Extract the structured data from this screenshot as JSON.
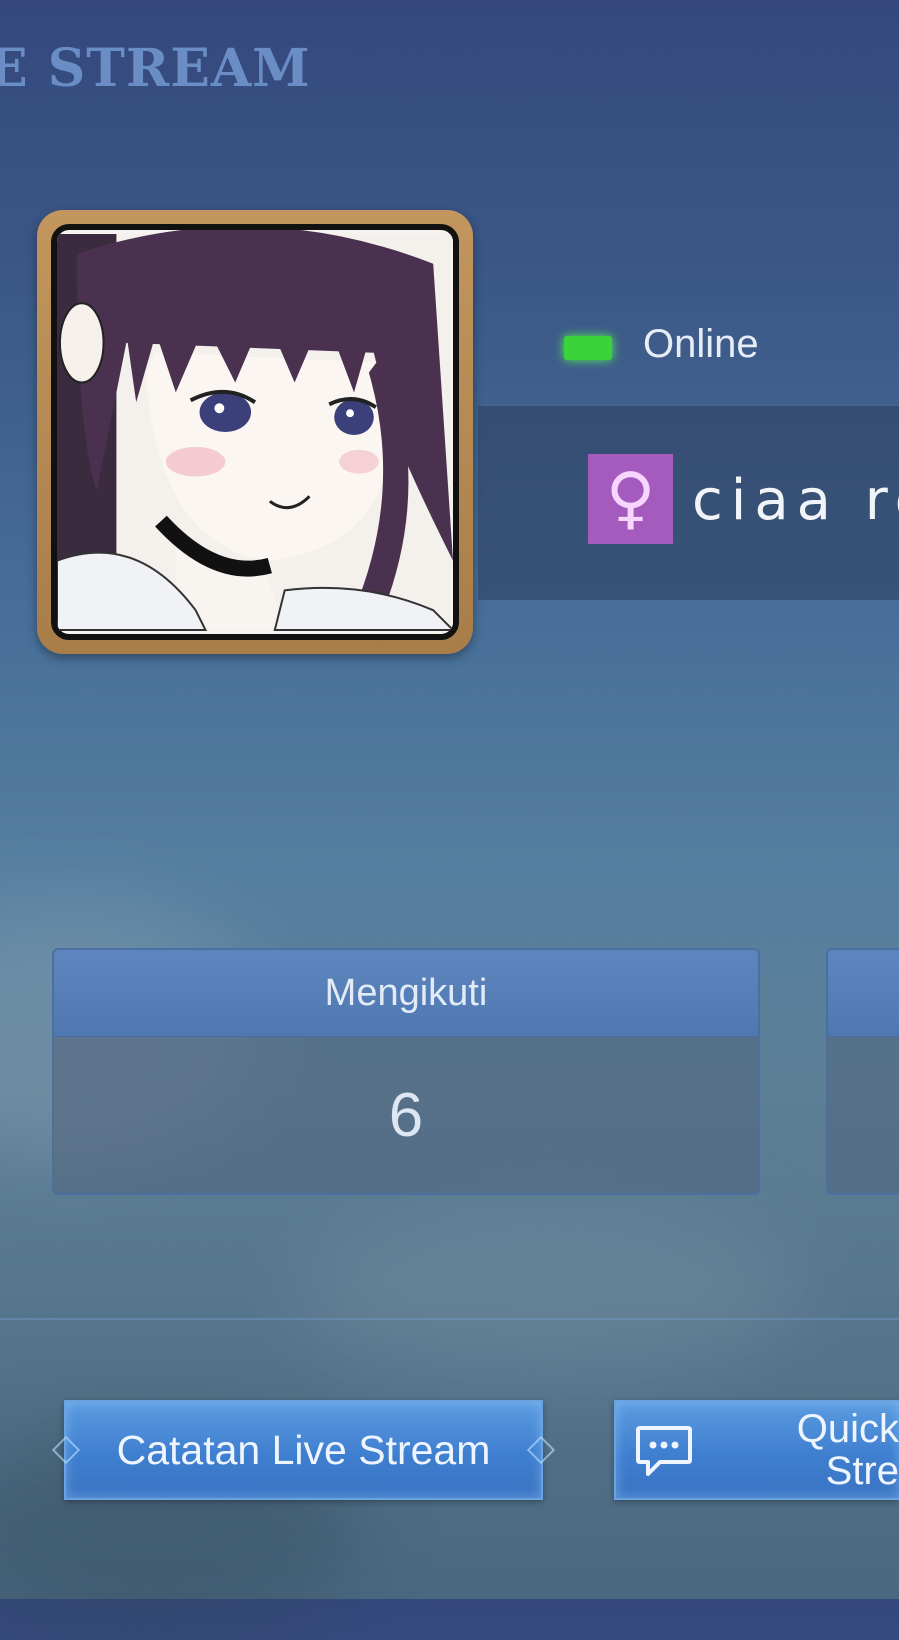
{
  "header": {
    "title": "E STREAM"
  },
  "profile": {
    "status": "Online",
    "status_color": "#3ad33a",
    "gender_symbol": "♀",
    "gender_color": "#a45bbd",
    "username": "ciaa ro"
  },
  "stats": [
    {
      "label": "Mengikuti",
      "value": "6"
    },
    {
      "label": "",
      "value": ""
    }
  ],
  "actions": {
    "records_label": "Catatan Live Stream",
    "quick_label_line1": "Quick",
    "quick_label_line2": "Stre",
    "quick_icon": "chat-bubble-icon"
  },
  "colors": {
    "accent_button": "#3f7fd0",
    "frame_gold": "#c2965e"
  }
}
